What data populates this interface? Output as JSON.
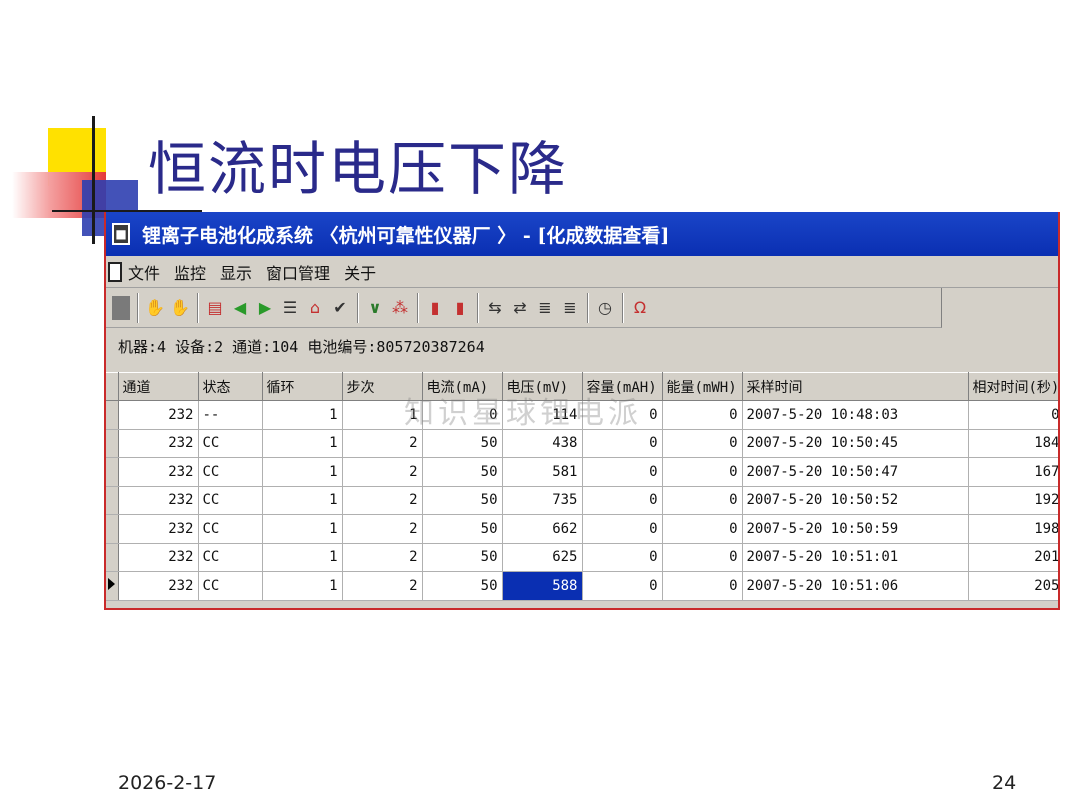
{
  "slide": {
    "title": "恒流时电压下降",
    "date": "2026-2-17",
    "page": "24",
    "watermark": "知识星球锂电派"
  },
  "window": {
    "title": "锂离子电池化成系统 〈杭州可靠性仪器厂 〉 - [化成数据查看]",
    "menu": [
      "文件",
      "监控",
      "显示",
      "窗口管理",
      "关于"
    ],
    "toolbar_icons": [
      "stop-icon",
      "sep",
      "hand-icon",
      "hand-red-icon",
      "sep",
      "monitor-icon",
      "arrow-left-icon",
      "arrow-right-icon",
      "list-icon",
      "chart-icon",
      "check-icon",
      "sep",
      "v-icon",
      "cluster-icon",
      "sep",
      "battery-red-icon",
      "battery-plus-icon",
      "sep",
      "connect-left-icon",
      "connect-right-icon",
      "cell-stack-icon",
      "cell-stack-2-icon",
      "sep",
      "clock-icon",
      "sep",
      "magnet-icon"
    ]
  },
  "info": "机器:4  设备:2  通道:104  电池编号:805720387264",
  "table": {
    "headers": [
      "通道",
      "状态",
      "循环",
      "步次",
      "电流(mA)",
      "电压(mV)",
      "容量(mAH)",
      "能量(mWH)",
      "采样时间",
      "相对时间(秒)"
    ],
    "rows": [
      [
        "232",
        "--",
        "1",
        "1",
        "0",
        "114",
        "0",
        "0",
        "2007-5-20 10:48:03",
        "0"
      ],
      [
        "232",
        "CC",
        "1",
        "2",
        "50",
        "438",
        "0",
        "0",
        "2007-5-20 10:50:45",
        "184"
      ],
      [
        "232",
        "CC",
        "1",
        "2",
        "50",
        "581",
        "0",
        "0",
        "2007-5-20 10:50:47",
        "167"
      ],
      [
        "232",
        "CC",
        "1",
        "2",
        "50",
        "735",
        "0",
        "0",
        "2007-5-20 10:50:52",
        "192"
      ],
      [
        "232",
        "CC",
        "1",
        "2",
        "50",
        "662",
        "0",
        "0",
        "2007-5-20 10:50:59",
        "198"
      ],
      [
        "232",
        "CC",
        "1",
        "2",
        "50",
        "625",
        "0",
        "0",
        "2007-5-20 10:51:01",
        "201"
      ],
      [
        "232",
        "CC",
        "1",
        "2",
        "50",
        "588",
        "0",
        "0",
        "2007-5-20 10:51:06",
        "205"
      ]
    ],
    "selected_row": 6,
    "selected_col": 5
  }
}
